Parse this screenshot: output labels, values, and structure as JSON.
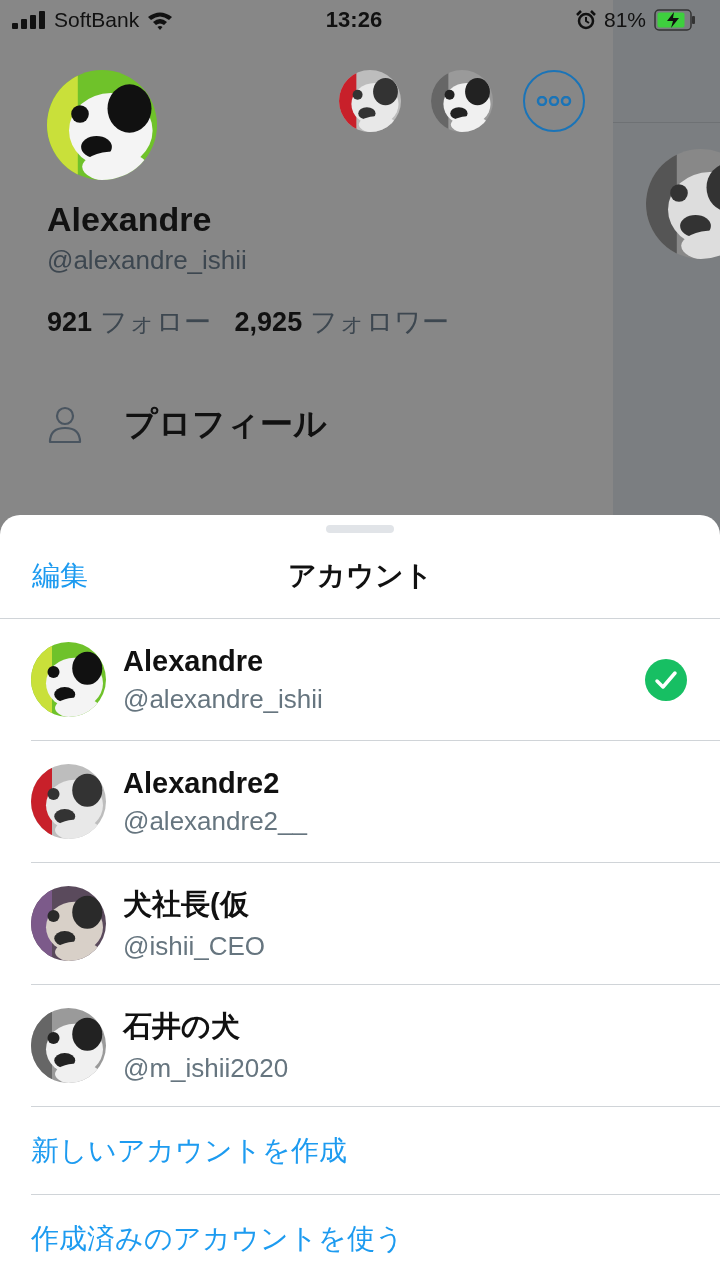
{
  "status_bar": {
    "carrier": "SoftBank",
    "time": "13:26",
    "battery": "81%"
  },
  "drawer": {
    "name": "Alexandre",
    "handle": "@alexandre_ishii",
    "stats": [
      {
        "count": "921",
        "label": "フォロー"
      },
      {
        "count": "2,925",
        "label": "フォロワー"
      }
    ],
    "menu": [
      {
        "label": "プロフィール"
      }
    ]
  },
  "sheet": {
    "edit_button": "編集",
    "title": "アカウント",
    "accounts": [
      {
        "name": "Alexandre",
        "handle": "@alexandre_ishii",
        "selected": true
      },
      {
        "name": "Alexandre2",
        "handle": "@alexandre2__",
        "selected": false
      },
      {
        "name": "犬社長(仮",
        "handle": "@ishii_CEO",
        "selected": false
      },
      {
        "name": "石井の犬",
        "handle": "@m_ishii2020",
        "selected": false
      }
    ],
    "actions": [
      "新しいアカウントを作成",
      "作成済みのアカウントを使う"
    ]
  }
}
